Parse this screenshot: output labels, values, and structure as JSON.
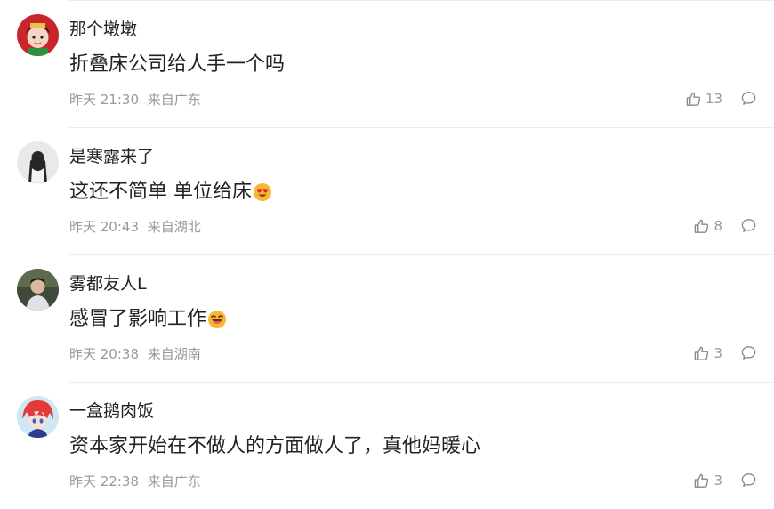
{
  "comments": [
    {
      "username": "那个墩墩",
      "content": "折叠床公司给人手一个吗",
      "emoji": "",
      "time": "昨天 21:30",
      "location": "来自广东",
      "likes": "13",
      "avatar_icon": "cartoon-character-red-avatar"
    },
    {
      "username": "是寒露来了",
      "content": "这还不简单 单位给床",
      "emoji": "heart-eyes-emoji",
      "time": "昨天 20:43",
      "location": "来自湖北",
      "likes": "8",
      "avatar_icon": "silhouette-girl-avatar"
    },
    {
      "username": "雾都友人L",
      "content": "感冒了影响工作",
      "emoji": "laughing-emoji",
      "time": "昨天 20:38",
      "location": "来自湖南",
      "likes": "3",
      "avatar_icon": "person-photo-avatar"
    },
    {
      "username": "一盒鹅肉饭",
      "content": "资本家开始在不做人的方面做人了，真他妈暖心",
      "emoji": "",
      "time": "昨天 22:38",
      "location": "来自广东",
      "likes": "3",
      "avatar_icon": "anime-red-hair-avatar"
    }
  ],
  "colors": {
    "text": "#222222",
    "meta": "#999999",
    "divider": "#ececec"
  }
}
